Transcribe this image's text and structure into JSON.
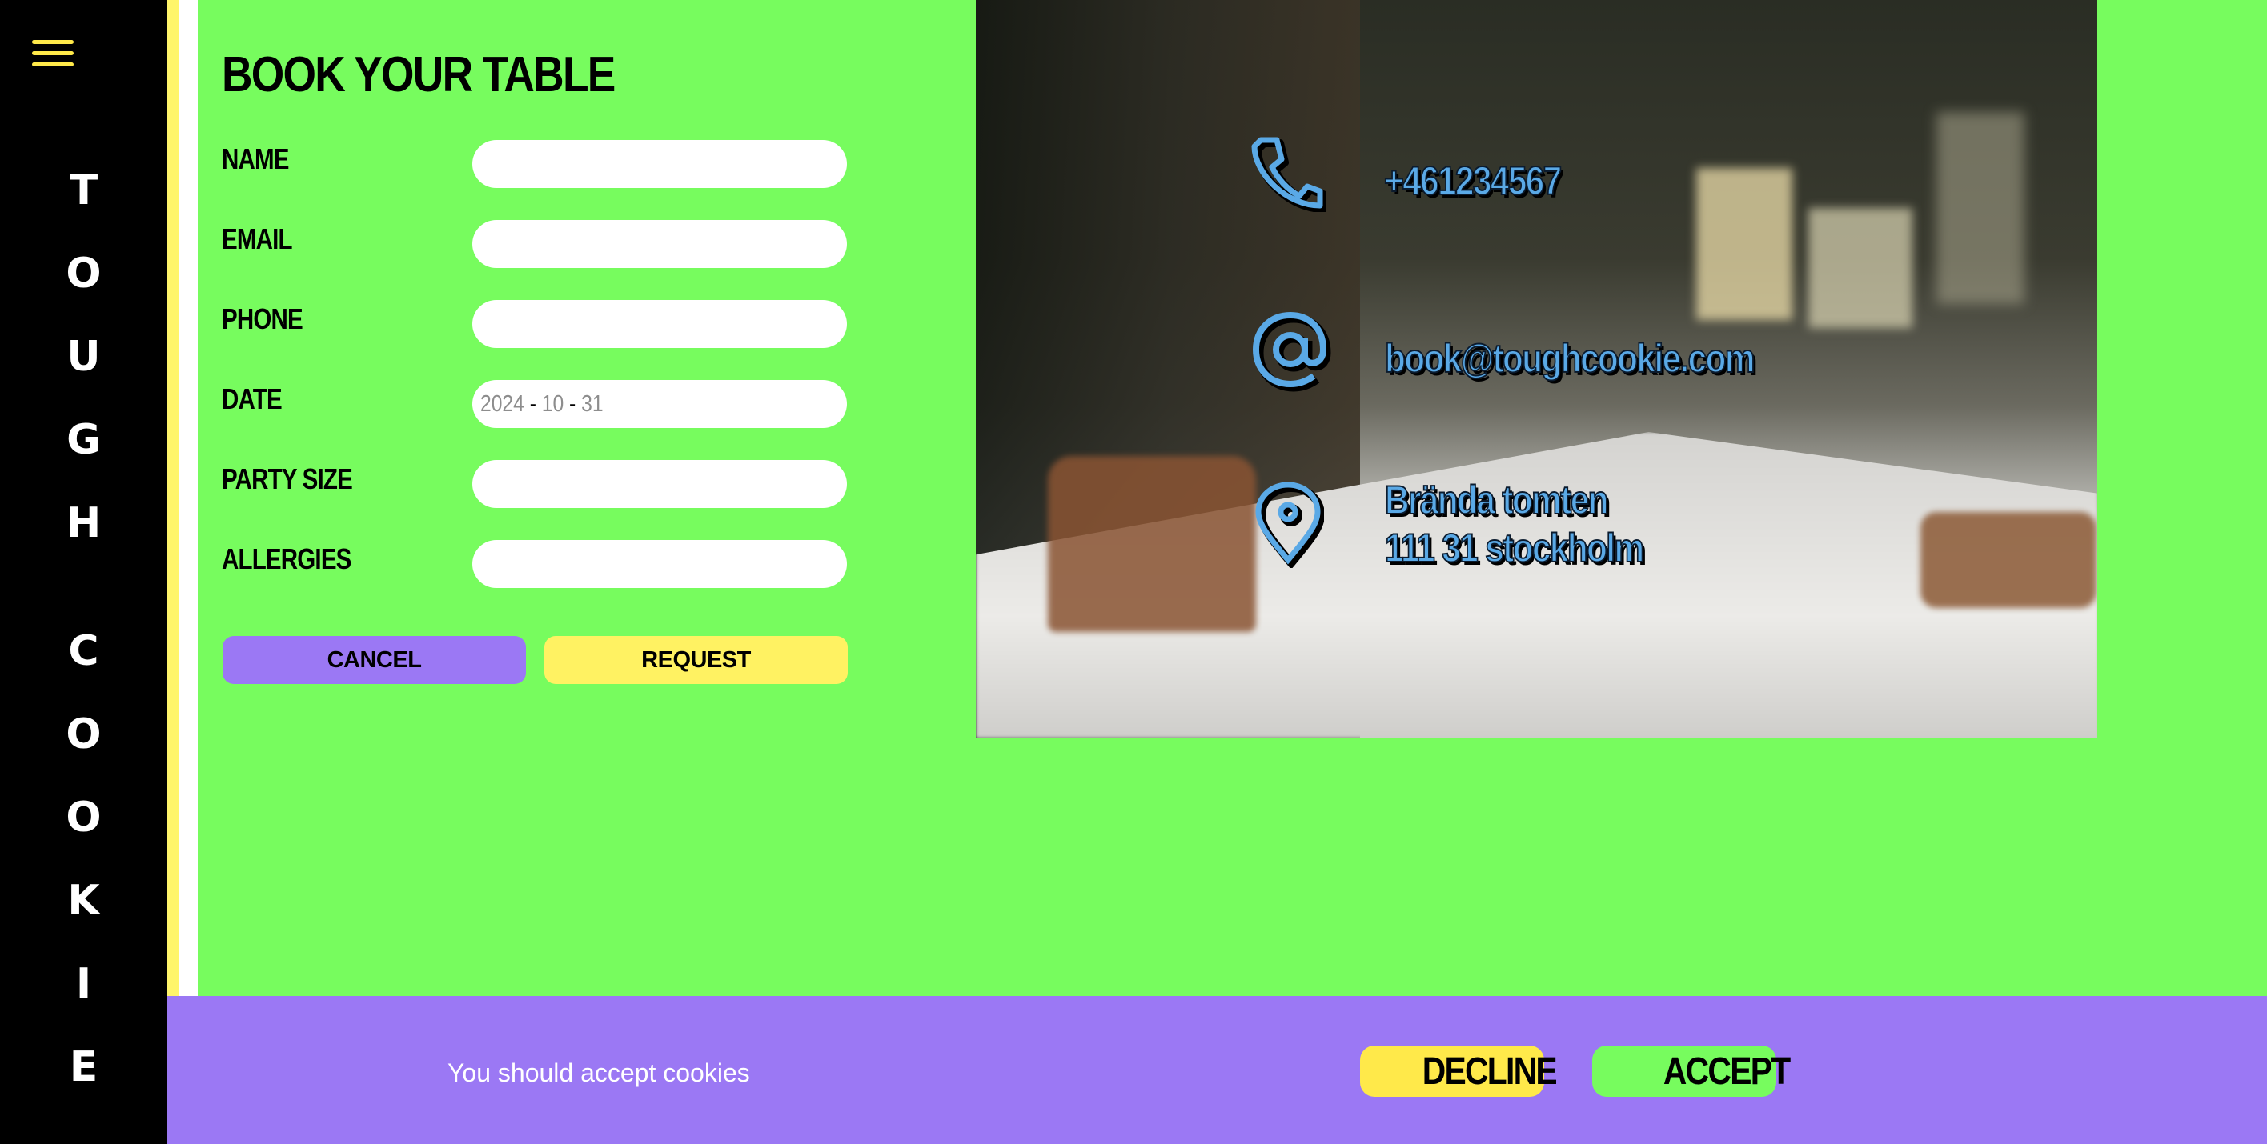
{
  "brand": {
    "letters": [
      "T",
      "O",
      "U",
      "G",
      "H",
      "C",
      "O",
      "O",
      "K",
      "I",
      "E"
    ]
  },
  "menu": {
    "icon": "hamburger-menu-icon"
  },
  "form": {
    "title": "BOOK YOUR TABLE",
    "fields": {
      "name": {
        "label": "NAME",
        "value": ""
      },
      "email": {
        "label": "EMAIL",
        "value": ""
      },
      "phone": {
        "label": "PHONE",
        "value": ""
      },
      "date": {
        "label": "DATE",
        "year": "2024",
        "month": "10",
        "day": "31",
        "sep": "-"
      },
      "party_size": {
        "label": "PARTY SIZE",
        "value": ""
      },
      "allergies": {
        "label": "ALLERGIES",
        "value": ""
      }
    },
    "cancel_label": "CANCEL",
    "request_label": "REQUEST"
  },
  "contact": {
    "phone": "+461234567",
    "email": "book@toughcookie.com",
    "address_line1": "Brända tomten",
    "address_line2": "111 31 stockholm",
    "icons": [
      "phone-icon",
      "at-sign-icon",
      "map-pin-icon"
    ],
    "text_color": "#5aa9e6"
  },
  "cookie_bar": {
    "message": "You should accept cookies",
    "decline_label": "DECLINE",
    "accept_label": "ACCEPT"
  },
  "colors": {
    "background": "#77fc5e",
    "sidebar": "#000000",
    "accent_yellow": "#fff262",
    "accent_purple": "#9b78f4"
  }
}
